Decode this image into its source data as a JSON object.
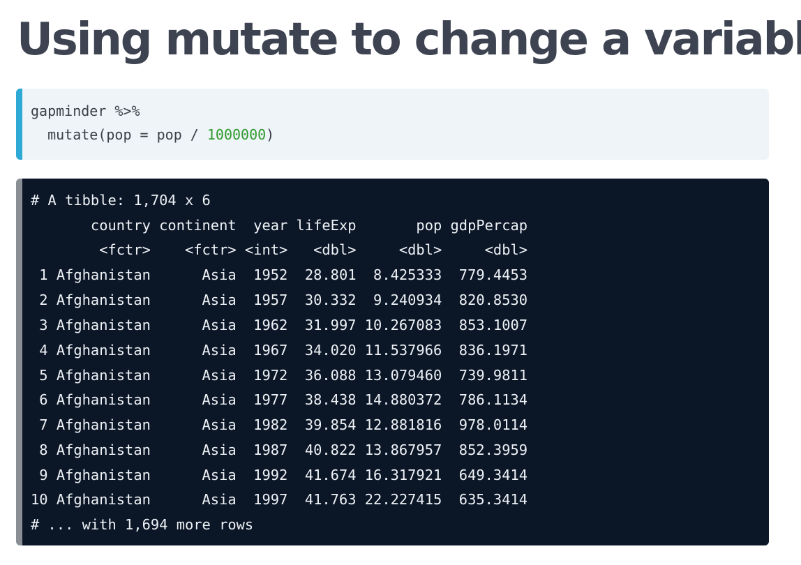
{
  "slide": {
    "title": "Using mutate to change a variable"
  },
  "code_input": {
    "line1": "gapminder %>%",
    "line2_prefix": "  mutate(pop = pop / ",
    "line2_number": "1000000",
    "line2_suffix": ")"
  },
  "code_output": {
    "lines": [
      "# A tibble: 1,704 x 6",
      "       country continent  year lifeExp       pop gdpPercap",
      "        <fctr>    <fctr> <int>   <dbl>     <dbl>     <dbl>",
      " 1 Afghanistan      Asia  1952  28.801  8.425333  779.4453",
      " 2 Afghanistan      Asia  1957  30.332  9.240934  820.8530",
      " 3 Afghanistan      Asia  1962  31.997 10.267083  853.1007",
      " 4 Afghanistan      Asia  1967  34.020 11.537966  836.1971",
      " 5 Afghanistan      Asia  1972  36.088 13.079460  739.9811",
      " 6 Afghanistan      Asia  1977  38.438 14.880372  786.1134",
      " 7 Afghanistan      Asia  1982  39.854 12.881816  978.0114",
      " 8 Afghanistan      Asia  1987  40.822 13.867957  852.3959",
      " 9 Afghanistan      Asia  1992  41.674 16.317921  649.3414",
      "10 Afghanistan      Asia  1997  41.763 22.227415  635.3414",
      "# ... with 1,694 more rows"
    ]
  },
  "colors": {
    "title": "#3d4351",
    "input_bg": "#eef4f7",
    "input_accent": "#2ea8d4",
    "output_bg": "#0b1627",
    "output_accent": "#8a8f96",
    "number_literal": "#2e9a2e"
  }
}
